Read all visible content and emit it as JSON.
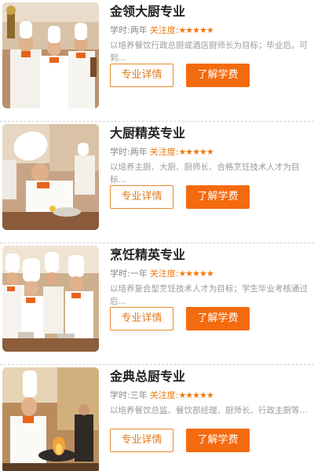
{
  "colors": {
    "accent": "#f46a0e",
    "outline": "#e58a2b",
    "stars": "#f07a0c"
  },
  "courses": [
    {
      "title": "金领大厨专业",
      "duration": "学时:两年",
      "attention_label": "关注度:",
      "stars": "★★★★★",
      "desc": "以培养餐饮行政总厨或酒店厨师长为目标；毕业后，可到...",
      "detail_btn": "专业详情",
      "fee_btn": "了解学费",
      "image_icon": "chefs-holding-trophy-photo"
    },
    {
      "title": "大厨精英专业",
      "duration": "学时:两年",
      "attention_label": "关注度:",
      "stars": "★★★★★",
      "desc": "以培养主厨、大厨、厨师长、合格烹饪技术人才为目标...",
      "detail_btn": "专业详情",
      "fee_btn": "了解学费",
      "image_icon": "chef-cooking-photo"
    },
    {
      "title": "烹饪精英专业",
      "duration": "学时:一年",
      "attention_label": "关注度:",
      "stars": "★★★★★",
      "desc": "以培养复合型烹饪技术人才为目标；学生毕业考核通过后...",
      "detail_btn": "专业详情",
      "fee_btn": "了解学费",
      "image_icon": "chef-students-class-photo"
    },
    {
      "title": "金典总厨专业",
      "duration": "学时:三年",
      "attention_label": "关注度:",
      "stars": "★★★★★",
      "desc": "以培养餐饮总监、餐饮部经理、厨师长、行政主厨等...",
      "detail_btn": "专业详情",
      "fee_btn": "了解学费",
      "image_icon": "chef-flame-wok-photo"
    }
  ]
}
